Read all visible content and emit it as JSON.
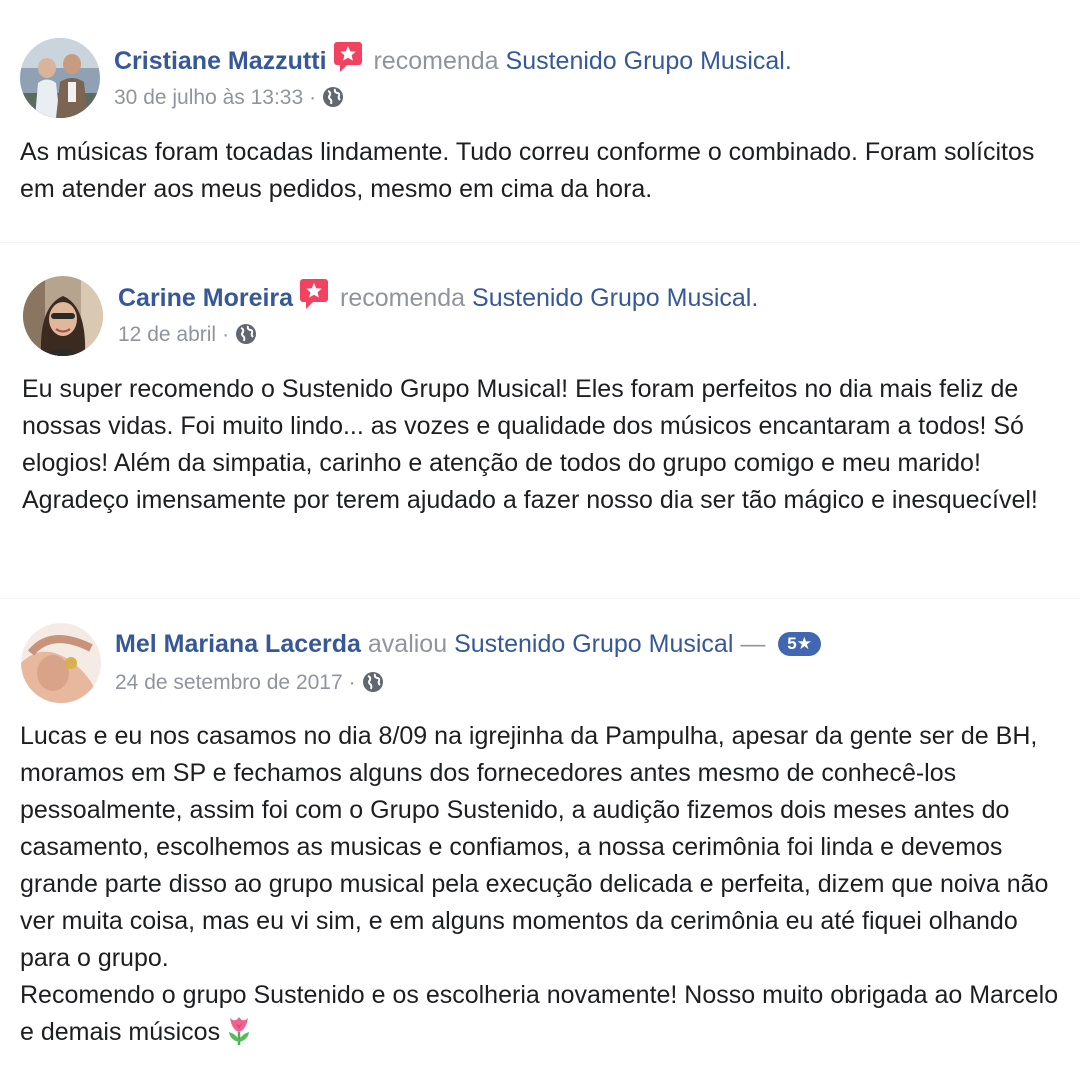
{
  "reviews": [
    {
      "author": "Cristiane Mazzutti",
      "verb": "recomenda",
      "page": "Sustenido Grupo Musical",
      "page_suffix": ".",
      "date": "30 de julho às 13:33",
      "separator": "·",
      "privacy_icon": "globe-icon",
      "badge_icon": "recommendation-star-icon",
      "body": "As músicas foram tocadas lindamente. Tudo correu conforme o combinado. Foram solícitos em atender aos meus pedidos, mesmo em cima da hora."
    },
    {
      "author": "Carine Moreira",
      "verb": "recomenda",
      "page": "Sustenido Grupo Musical",
      "page_suffix": ".",
      "date": "12 de abril",
      "separator": "·",
      "privacy_icon": "globe-icon",
      "badge_icon": "recommendation-star-icon",
      "body": "Eu super recomendo o Sustenido Grupo Musical! Eles foram perfeitos no dia mais feliz de nossas vidas. Foi muito lindo... as vozes e qualidade dos músicos encantaram a todos! Só elogios! Além da simpatia, carinho e atenção de todos do grupo comigo e meu marido! Agradeço imensamente por terem ajudado a fazer nosso dia ser tão mágico e inesquecível!"
    },
    {
      "author": "Mel Mariana Lacerda",
      "verb": "avaliou",
      "page": "Sustenido Grupo Musical",
      "dash": "—",
      "rating": "5★",
      "date": "24 de setembro de 2017",
      "separator": "·",
      "privacy_icon": "globe-icon",
      "body_lines": [
        "Lucas e eu nos casamos no dia 8/09 na igrejinha da Pampulha, apesar da gente ser de BH, moramos em SP e fechamos alguns dos fornecedores antes mesmo de conhecê-los pessoalmente, assim foi com o Grupo Sustenido, a audição fizemos dois meses antes do casamento, escolhemos as musicas e confiamos, a nossa cerimônia foi linda e devemos grande parte disso ao grupo musical pela execução delicada e perfeita, dizem que noiva não ver muita coisa, mas eu vi sim, e em alguns momentos da cerimônia eu até fiquei olhando para o grupo.",
        "Recomendo o grupo Sustenido e os escolheria novamente! Nosso muito obrigada ao Marcelo e demais músicos"
      ],
      "emoji_icon": "tulip-icon"
    }
  ],
  "colors": {
    "link": "#365899",
    "secondary_text": "#90949c",
    "body_text": "#1c1e21",
    "recommend_badge": "#f3425f",
    "rating_pill": "#4267b2"
  }
}
